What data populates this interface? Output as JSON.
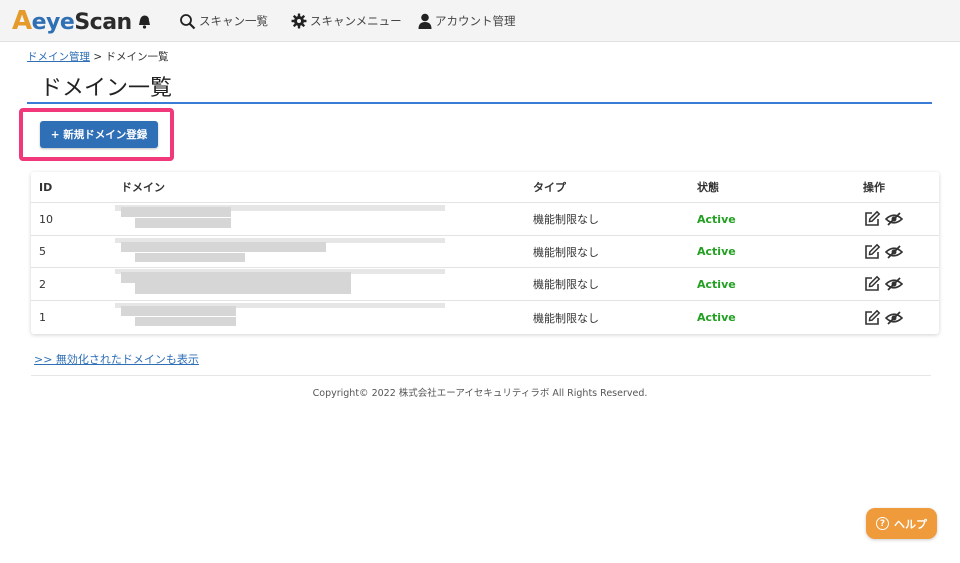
{
  "header": {
    "logo": {
      "a": "A",
      "eye": "eye",
      "rest": "Scan"
    },
    "nav": [
      {
        "label": "スキャン一覧",
        "icon": "search-icon"
      },
      {
        "label": "スキャンメニュー",
        "icon": "gear-icon"
      },
      {
        "label": "アカウント管理",
        "icon": "user-icon"
      }
    ]
  },
  "breadcrumb": {
    "parent": "ドメイン管理",
    "separator": " > ",
    "current": "ドメイン一覧"
  },
  "page_title": "ドメイン一覧",
  "add_button_label": "+ 新規ドメイン登録",
  "table": {
    "headers": {
      "id": "ID",
      "domain": "ドメイン",
      "type": "タイプ",
      "state": "状態",
      "ops": "操作"
    },
    "rows": [
      {
        "id": "10",
        "type": "機能制限なし",
        "state": "Active"
      },
      {
        "id": "5",
        "type": "機能制限なし",
        "state": "Active"
      },
      {
        "id": "2",
        "type": "機能制限なし",
        "state": "Active"
      },
      {
        "id": "1",
        "type": "機能制限なし",
        "state": "Active"
      }
    ]
  },
  "show_disabled_link": ">> 無効化されたドメインも表示",
  "footer": "Copyright© 2022 株式会社エーアイセキュリティラボ All Rights Reserved.",
  "help_button": {
    "icon": "?",
    "label": "ヘルプ"
  },
  "colors": {
    "accent": "#2f6fb6",
    "highlight": "#f0387a",
    "active": "#22a022",
    "help": "#ef9a3b"
  }
}
